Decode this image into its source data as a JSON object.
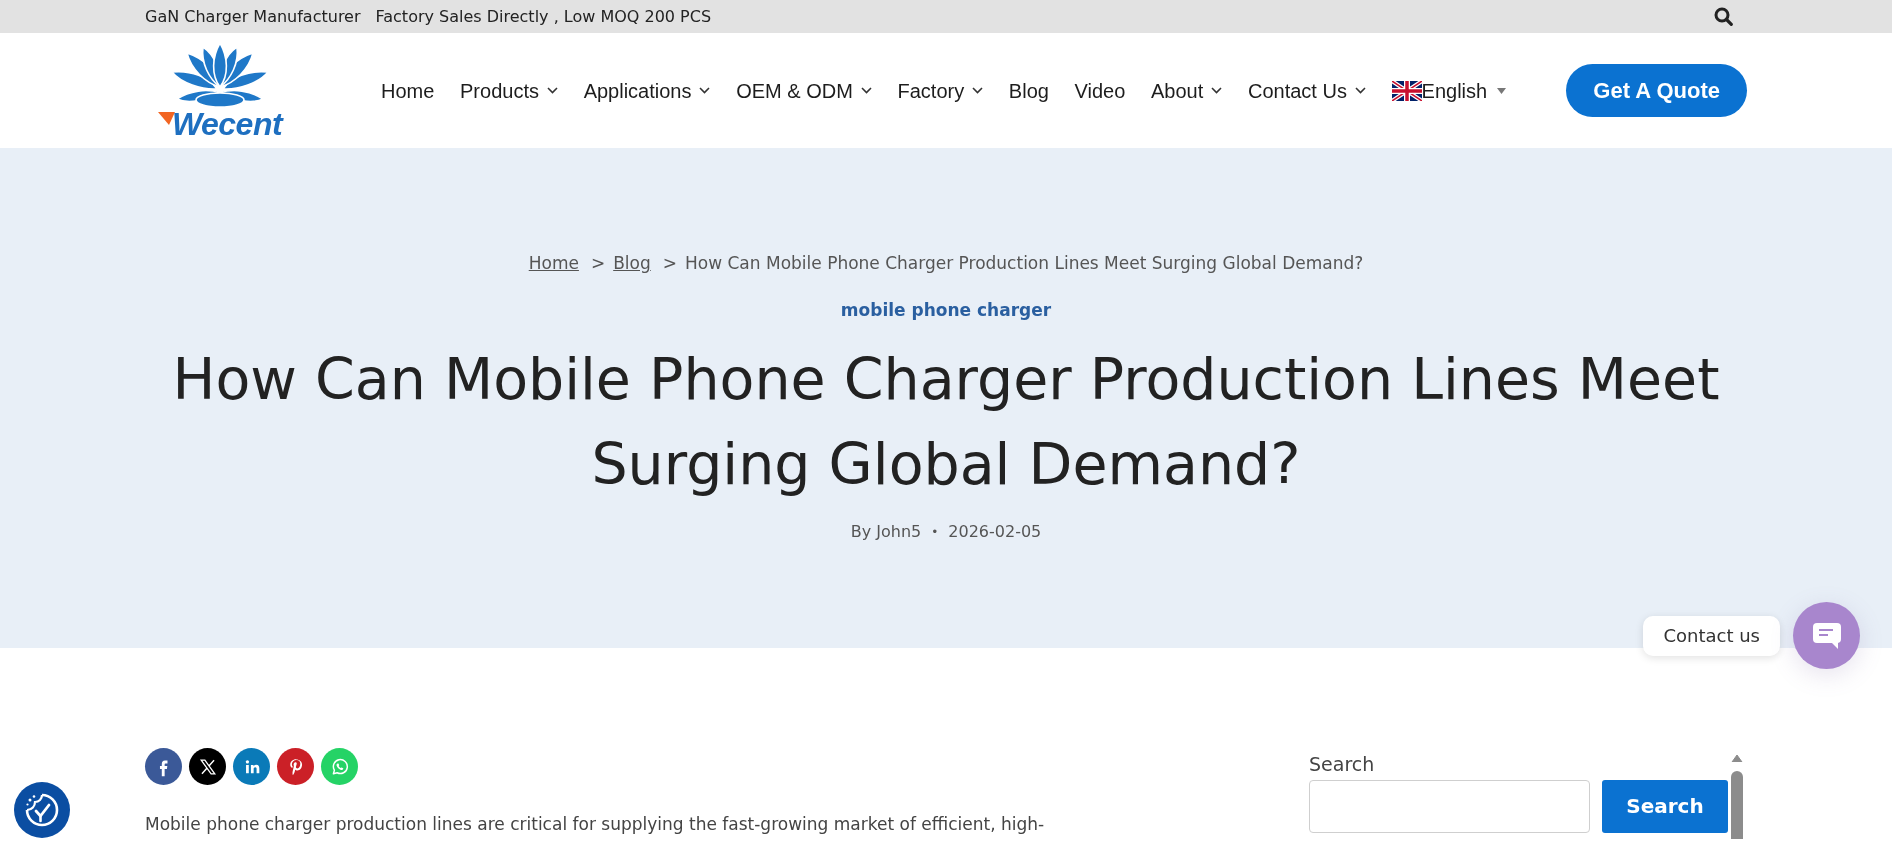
{
  "top_bar": {
    "texts": [
      "GaN Charger Manufacturer",
      "Factory Sales Directly , Low MOQ 200 PCS"
    ]
  },
  "header": {
    "logo": {
      "wordmark": "Wecent"
    },
    "nav": [
      {
        "label": "Home",
        "has_menu": false
      },
      {
        "label": "Products",
        "has_menu": true
      },
      {
        "label": "Applications",
        "has_menu": true
      },
      {
        "label": "OEM & ODM",
        "has_menu": true
      },
      {
        "label": "Factory",
        "has_menu": true
      },
      {
        "label": "Blog",
        "has_menu": false
      },
      {
        "label": "Video",
        "has_menu": false
      },
      {
        "label": "About",
        "has_menu": true
      },
      {
        "label": "Contact Us",
        "has_menu": true
      }
    ],
    "language": {
      "label": "English"
    },
    "cta": "Get A Quote"
  },
  "hero": {
    "breadcrumb": [
      {
        "label": "Home",
        "kind": "link"
      },
      {
        "separator": ">",
        "label": "Blog",
        "kind": "link"
      },
      {
        "separator": ">",
        "label": "How Can Mobile Phone Charger Production Lines Meet Surging Global Demand?",
        "kind": "current"
      }
    ],
    "category": "mobile phone charger",
    "title": "How Can Mobile Phone Charger Production Lines Meet Surging Global Demand?",
    "meta": {
      "author": "By John5",
      "separator": "•",
      "date": "2026-02-05"
    }
  },
  "share_buttons": [
    {
      "kind": "facebook",
      "color": "#3b5998"
    },
    {
      "kind": "x",
      "color": "#000000"
    },
    {
      "kind": "linkedin",
      "color": "#0a7ab8"
    },
    {
      "kind": "pinterest",
      "color": "#cb2027"
    },
    {
      "kind": "whatsapp",
      "color": "#25d366"
    }
  ],
  "article": {
    "paragraph": "Mobile phone charger production lines are critical for supplying the fast-growing market of efficient, high-"
  },
  "sidebar": {
    "search": {
      "label": "Search",
      "button": "Search"
    }
  },
  "chat_widget": {
    "label": "Contact us"
  }
}
